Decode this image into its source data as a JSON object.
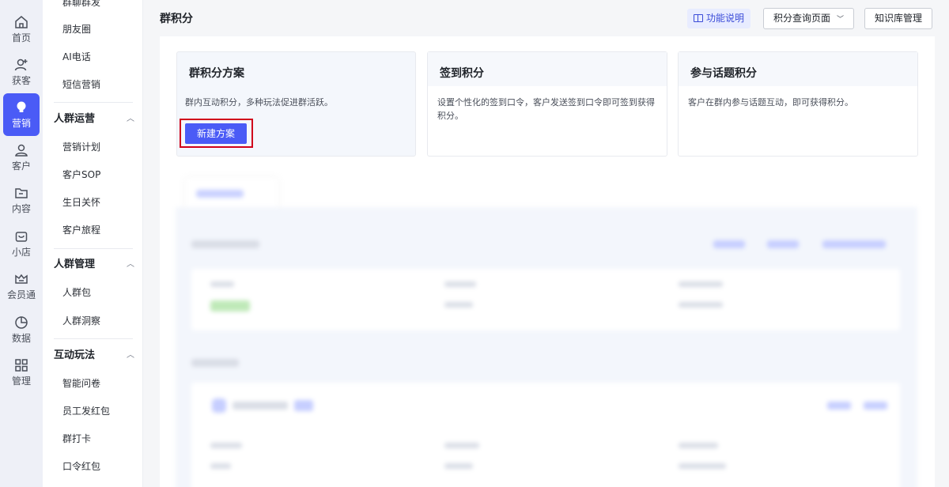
{
  "rail": [
    {
      "label": "首页",
      "icon": "home-icon"
    },
    {
      "label": "获客",
      "icon": "user-add-icon"
    },
    {
      "label": "营销",
      "icon": "bulb-icon"
    },
    {
      "label": "客户",
      "icon": "user-icon"
    },
    {
      "label": "内容",
      "icon": "folder-icon"
    },
    {
      "label": "小店",
      "icon": "shop-icon"
    },
    {
      "label": "会员通",
      "icon": "crown-icon"
    },
    {
      "label": "数据",
      "icon": "pie-chart-icon"
    },
    {
      "label": "管理",
      "icon": "grid-icon"
    }
  ],
  "sub": {
    "top_items": [
      "群聊群发",
      "朋友圈",
      "AI电话",
      "短信营销"
    ],
    "groups": [
      {
        "title": "人群运营",
        "items": [
          "营销计划",
          "客户SOP",
          "生日关怀",
          "客户旅程"
        ]
      },
      {
        "title": "人群管理",
        "items": [
          "人群包",
          "人群洞察"
        ]
      },
      {
        "title": "互动玩法",
        "items": [
          "智能问卷",
          "员工发红包",
          "群打卡",
          "口令红包"
        ]
      }
    ]
  },
  "header": {
    "title": "群积分",
    "func_label": "功能说明",
    "query_label": "积分查询页面",
    "kb_label": "知识库管理"
  },
  "cards": [
    {
      "title": "群积分方案",
      "desc": "群内互动积分，多种玩法促进群活跃。",
      "button": "新建方案"
    },
    {
      "title": "签到积分",
      "desc": "设置个性化的签到口令，客户发送签到口令即可签到获得积分。"
    },
    {
      "title": "参与话题积分",
      "desc": "客户在群内参与话题互动，即可获得积分。"
    }
  ],
  "colors": {
    "accent": "#4a5bf6",
    "highlight_box": "#d0021b",
    "rail_bg": "#eef0f7"
  }
}
